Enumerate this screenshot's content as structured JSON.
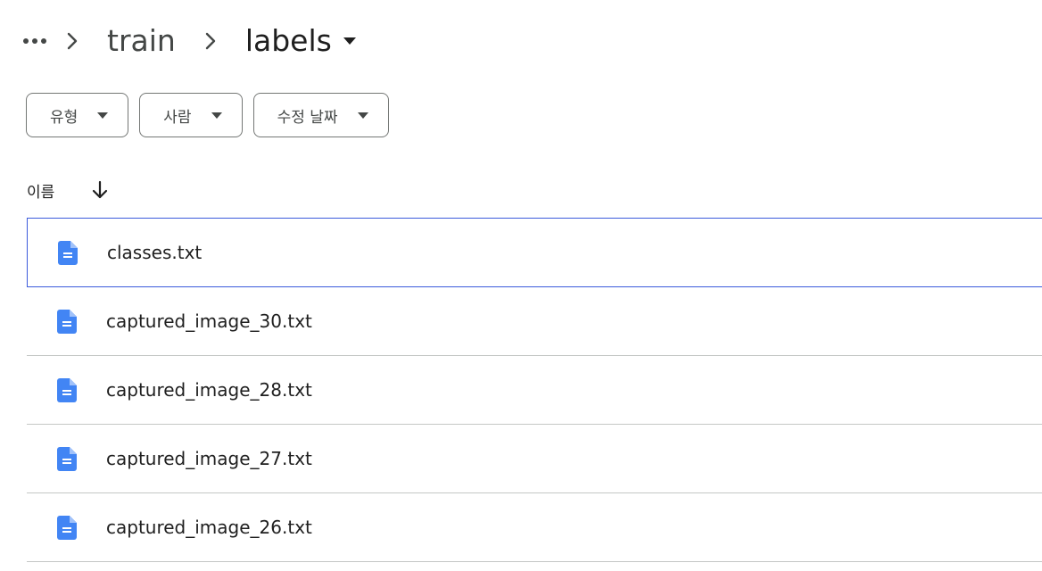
{
  "breadcrumb": {
    "more_icon": "more-horiz-icon",
    "separator_icon": "chevron-right-icon",
    "items": [
      "train"
    ],
    "current": "labels",
    "current_caret_icon": "arrow-drop-down-icon"
  },
  "filters": [
    {
      "label": "유형",
      "icon": "arrow-drop-down-icon"
    },
    {
      "label": "사람",
      "icon": "arrow-drop-down-icon"
    },
    {
      "label": "수정 날짜",
      "icon": "arrow-drop-down-icon"
    }
  ],
  "list_header": {
    "name_label": "이름",
    "sort_icon": "arrow-downward-icon"
  },
  "files": [
    {
      "name": "classes.txt",
      "icon": "document-icon",
      "selected": true
    },
    {
      "name": "captured_image_30.txt",
      "icon": "document-icon",
      "selected": false
    },
    {
      "name": "captured_image_28.txt",
      "icon": "document-icon",
      "selected": false
    },
    {
      "name": "captured_image_27.txt",
      "icon": "document-icon",
      "selected": false
    },
    {
      "name": "captured_image_26.txt",
      "icon": "document-icon",
      "selected": false
    }
  ],
  "colors": {
    "doc_icon": "#4285f4",
    "selected_border": "#3b5bdb",
    "divider": "#c4c7c5",
    "chip_border": "#747775"
  }
}
